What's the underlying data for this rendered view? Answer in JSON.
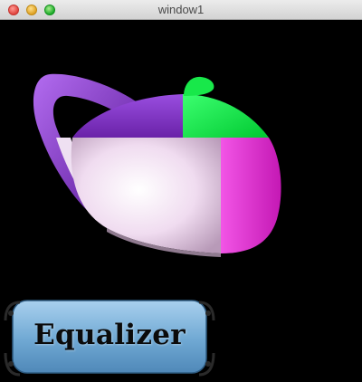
{
  "window": {
    "title": "window1"
  },
  "scene": {
    "object": "teapot",
    "quadrant_colors": {
      "top_left": "#7a2ec0",
      "top_right": "#00f040",
      "bottom_left": "#f2dff2",
      "bottom_right": "#ee33dd"
    }
  },
  "logo": {
    "text": "Equalizer",
    "color": "#6fa8d3"
  }
}
